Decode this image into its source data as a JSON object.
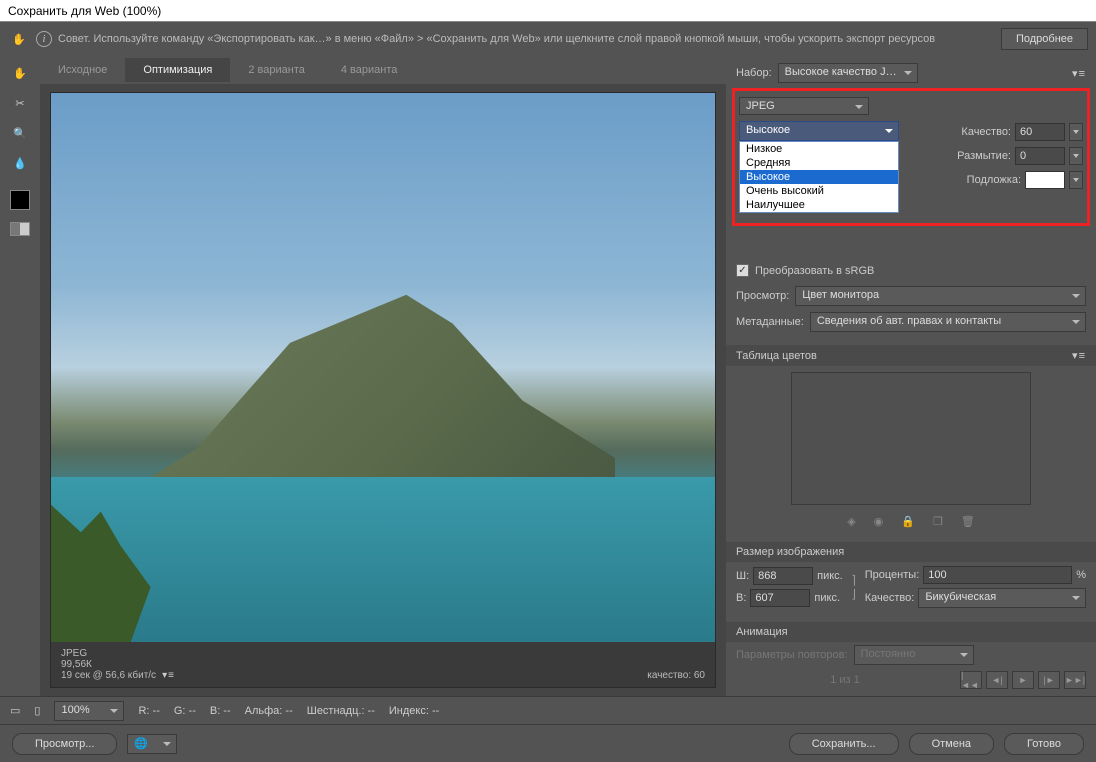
{
  "window": {
    "title": "Сохранить для Web (100%)"
  },
  "infobar": {
    "tip": "Совет. Используйте команду «Экспортировать как…» в меню «Файл» > «Сохранить для Web» или щелкните слой правой кнопкой мыши, чтобы ускорить экспорт ресурсов",
    "more": "Подробнее"
  },
  "tabs": {
    "t0": "Исходное",
    "t1": "Оптимизация",
    "t2": "2 варианта",
    "t3": "4 варианта"
  },
  "preview": {
    "format": "JPEG",
    "size": "99,56К",
    "time": "19 сек @ 56,6 кбит/с",
    "quality_label": "качество: 60"
  },
  "preset": {
    "label": "Набор:",
    "value": "Высокое качество J…"
  },
  "format_select": "JPEG",
  "quality_preset": {
    "selected": "Высокое",
    "options": {
      "o0": "Низкое",
      "o1": "Средняя",
      "o2": "Высокое",
      "o3": "Очень высокий",
      "o4": "Наилучшее"
    }
  },
  "quality": {
    "label": "Качество:",
    "value": "60"
  },
  "blur": {
    "label": "Размытие:",
    "value": "0"
  },
  "matte": {
    "label": "Подложка:"
  },
  "srgb": {
    "label": "Преобразовать в sRGB"
  },
  "preview_mode": {
    "label": "Просмотр:",
    "value": "Цвет монитора"
  },
  "metadata": {
    "label": "Метаданные:",
    "value": "Сведения об авт. правах и контакты"
  },
  "color_table": "Таблица цветов",
  "image_size": {
    "header": "Размер изображения",
    "w_label": "Ш:",
    "w": "868",
    "h_label": "В:",
    "h": "607",
    "unit": "пикс.",
    "percent_label": "Проценты:",
    "percent": "100",
    "quality_label": "Качество:",
    "quality_value": "Бикубическая"
  },
  "animation": {
    "header": "Анимация",
    "loop_label": "Параметры повторов:",
    "loop_value": "Постоянно",
    "frame": "1 из 1"
  },
  "bottom": {
    "zoom": "100%",
    "r": "R: --",
    "g": "G: --",
    "b": "B: --",
    "alpha": "Альфа: --",
    "hex": "Шестнадц.: --",
    "index": "Индекс: --"
  },
  "footer": {
    "preview": "Просмотр...",
    "save": "Сохранить...",
    "cancel": "Отмена",
    "done": "Готово"
  }
}
